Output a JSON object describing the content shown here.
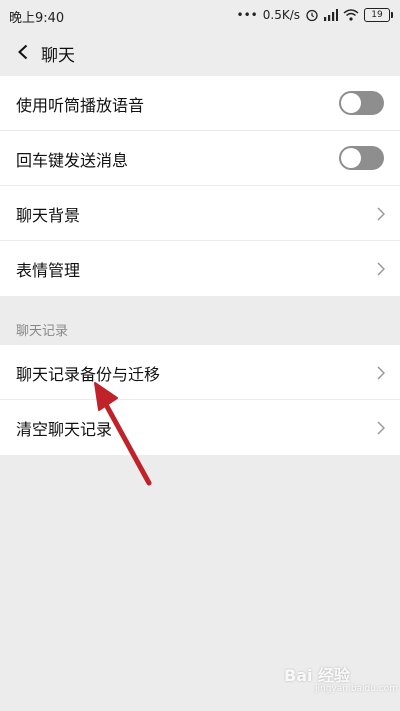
{
  "status_bar": {
    "time": "晚上9:40",
    "network_speed": "0.5K/s",
    "battery": "19",
    "icons": [
      "alarm-icon",
      "signal-icon",
      "wifi-icon",
      "battery-icon"
    ]
  },
  "header": {
    "back_icon": "chevron-left-icon",
    "title": "聊天"
  },
  "settings": {
    "items": [
      {
        "label": "使用听筒播放语音",
        "control": "toggle",
        "state": "off"
      },
      {
        "label": "回车键发送消息",
        "control": "toggle",
        "state": "off"
      },
      {
        "label": "聊天背景",
        "control": "chevron"
      },
      {
        "label": "表情管理",
        "control": "chevron"
      }
    ]
  },
  "chat_records": {
    "section_title": "聊天记录",
    "items": [
      {
        "label": "聊天记录备份与迁移",
        "control": "chevron"
      },
      {
        "label": "清空聊天记录",
        "control": "chevron"
      }
    ]
  },
  "annotation": {
    "arrow_color": "#c0222a"
  },
  "watermark": {
    "text": "Bai 经验",
    "subtext": "jingyan.baidu.com"
  }
}
